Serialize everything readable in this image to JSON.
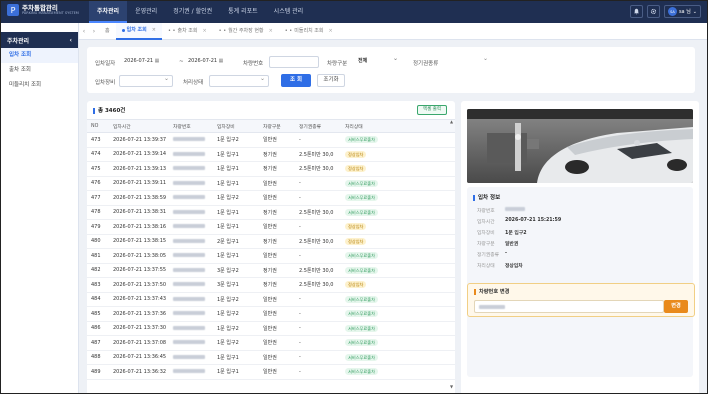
{
  "app": {
    "logo_icon": "P",
    "title": "주차통합관리",
    "subtitle": "PARKING MANAGEMENT SYSTEM"
  },
  "topnav": {
    "items": [
      {
        "label": "주차관리",
        "active": true
      },
      {
        "label": "운영관리",
        "active": false
      },
      {
        "label": "정기권 / 할인권",
        "active": false
      },
      {
        "label": "통계 리포트",
        "active": false
      },
      {
        "label": "시스템 관리",
        "active": false
      }
    ],
    "user": {
      "avatar": "SA",
      "name": "sa 님"
    },
    "icons": [
      "bell-icon",
      "gear-icon"
    ]
  },
  "sidebar": {
    "header": "주차관리",
    "collapse_glyph": "‹",
    "items": [
      {
        "label": "입차 조회",
        "active": true
      },
      {
        "label": "출차 조회",
        "active": false
      },
      {
        "label": "미들리치 조회",
        "active": false
      }
    ]
  },
  "tabs": [
    {
      "label": "홈",
      "active": false
    },
    {
      "label": "입차 조회",
      "active": true
    },
    {
      "label": "출차 조회",
      "active": false
    },
    {
      "label": "월간 주차장 현황",
      "active": false
    },
    {
      "label": "미들리치 조회",
      "active": false
    }
  ],
  "filter": {
    "entry_time_label": "입차일자",
    "date_from": "2026-07-21",
    "date_to": "2026-07-21",
    "range_sep": "~",
    "plate_label": "차량번호",
    "plate_value": "",
    "vehicle_type_label": "차량구분",
    "vehicle_type_value": "전체",
    "season_type_label": "정기권종류",
    "season_type_value": "",
    "gate_label": "입차장비",
    "gate_value": "",
    "process_label": "처리상태",
    "process_value": "",
    "search_btn": "조 회",
    "reset_btn": "조기화"
  },
  "table": {
    "total": "총 3460건",
    "excel_btn": "엑셀 출력",
    "columns": [
      "NO",
      "입차시간",
      "차량번호",
      "입차장비",
      "차량구분",
      "정기권종류",
      "처리상태"
    ],
    "rows": [
      {
        "no": "473",
        "time": "2026-07-21 13:39:37",
        "gate": "1문 입구2",
        "type": "일반권",
        "season": "-",
        "status": "서비스무료출차",
        "status_color": "green"
      },
      {
        "no": "474",
        "time": "2026-07-21 13:39:14",
        "gate": "1문 입구1",
        "type": "정기권",
        "season": "2.5톤미만 30,0",
        "status": "정상입차",
        "status_color": "yellow"
      },
      {
        "no": "475",
        "time": "2026-07-21 13:39:13",
        "gate": "1문 입구1",
        "type": "정기권",
        "season": "2.5톤미만 30,0",
        "status": "정상입차",
        "status_color": "yellow"
      },
      {
        "no": "476",
        "time": "2026-07-21 13:39:11",
        "gate": "1문 입구1",
        "type": "일반권",
        "season": "-",
        "status": "서비스무료출차",
        "status_color": "green"
      },
      {
        "no": "477",
        "time": "2026-07-21 13:38:59",
        "gate": "1문 입구2",
        "type": "일반권",
        "season": "-",
        "status": "서비스무료출차",
        "status_color": "green"
      },
      {
        "no": "478",
        "time": "2026-07-21 13:38:31",
        "gate": "1문 입구1",
        "type": "정기권",
        "season": "2.5톤미만 30,0",
        "status": "서비스무료출차",
        "status_color": "green"
      },
      {
        "no": "479",
        "time": "2026-07-21 13:38:16",
        "gate": "1문 입구1",
        "type": "일반권",
        "season": "-",
        "status": "정상입차",
        "status_color": "yellow"
      },
      {
        "no": "480",
        "time": "2026-07-21 13:38:15",
        "gate": "2문 입구1",
        "type": "정기권",
        "season": "2.5톤미만 30,0",
        "status": "정상입차",
        "status_color": "yellow"
      },
      {
        "no": "481",
        "time": "2026-07-21 13:38:05",
        "gate": "1문 입구1",
        "type": "일반권",
        "season": "-",
        "status": "서비스무료출차",
        "status_color": "green"
      },
      {
        "no": "482",
        "time": "2026-07-21 13:37:55",
        "gate": "3문 입구2",
        "type": "정기권",
        "season": "2.5톤미만 30,0",
        "status": "서비스무료출차",
        "status_color": "green"
      },
      {
        "no": "483",
        "time": "2026-07-21 13:37:50",
        "gate": "3문 입구1",
        "type": "정기권",
        "season": "2.5톤미만 30,0",
        "status": "정상입차",
        "status_color": "yellow"
      },
      {
        "no": "484",
        "time": "2026-07-21 13:37:43",
        "gate": "1문 입구2",
        "type": "일반권",
        "season": "-",
        "status": "서비스무료출차",
        "status_color": "green"
      },
      {
        "no": "485",
        "time": "2026-07-21 13:37:36",
        "gate": "1문 입구2",
        "type": "일반권",
        "season": "-",
        "status": "서비스무료출차",
        "status_color": "green"
      },
      {
        "no": "486",
        "time": "2026-07-21 13:37:30",
        "gate": "1문 입구2",
        "type": "일반권",
        "season": "-",
        "status": "서비스무료출차",
        "status_color": "green"
      },
      {
        "no": "487",
        "time": "2026-07-21 13:37:08",
        "gate": "1문 입구2",
        "type": "일반권",
        "season": "-",
        "status": "서비스무료출차",
        "status_color": "green"
      },
      {
        "no": "488",
        "time": "2026-07-21 13:36:45",
        "gate": "1문 입구1",
        "type": "일반권",
        "season": "-",
        "status": "서비스무료출차",
        "status_color": "green"
      },
      {
        "no": "489",
        "time": "2026-07-21 13:36:32",
        "gate": "1문 입구1",
        "type": "일반권",
        "season": "-",
        "status": "서비스무료출차",
        "status_color": "green"
      }
    ]
  },
  "detail": {
    "title": "입차 정보",
    "rows": [
      {
        "key": "차량번호",
        "value": ""
      },
      {
        "key": "입차시간",
        "value": "2026-07-21 15:21:59"
      },
      {
        "key": "입차장비",
        "value": "1문 입구2"
      },
      {
        "key": "차량구분",
        "value": "일반권"
      },
      {
        "key": "정기권종류",
        "value": "-"
      },
      {
        "key": "처리상태",
        "value": "정상입차"
      }
    ]
  },
  "plate_change": {
    "title": "차량번호 변경",
    "button": "변경"
  },
  "colors": {
    "navy": "#1f2f52",
    "accent": "#2f6ee6",
    "green": "#2f9a5d",
    "orange": "#e98a1c"
  }
}
